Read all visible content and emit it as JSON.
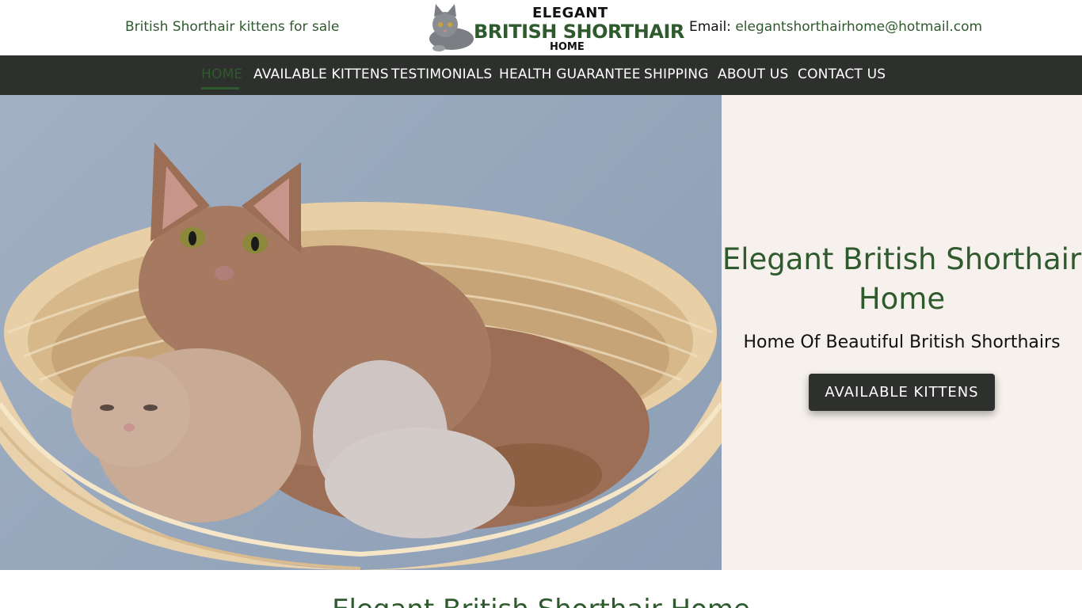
{
  "header": {
    "tagline": "British Shorthair kittens for sale",
    "logo": {
      "line1": "ELEGANT",
      "line2": "BRITISH SHORTHAIR",
      "line3": "HOME"
    },
    "email_label": "Email:",
    "email_address": "elegantshorthairhome@hotmail.com"
  },
  "nav": {
    "items": [
      {
        "label": "HOME",
        "active": true
      },
      {
        "label": "AVAILABLE KITTENS"
      },
      {
        "label": "TESTIMONIALS"
      },
      {
        "label": "HEALTH GUARANTEE"
      },
      {
        "label": "SHIPPING"
      },
      {
        "label": "ABOUT US"
      },
      {
        "label": "CONTACT US"
      }
    ]
  },
  "hero": {
    "image_icon": "cats-in-basket-photo",
    "title": "Elegant British Shorthair Home",
    "subtitle": "Home Of Beautiful British Shorthairs",
    "button": "AVAILABLE KITTENS"
  },
  "section": {
    "title": "Elegant British Shorthair Home"
  },
  "colors": {
    "brand_green": "#2f5a2d",
    "nav_bg": "#2e302e",
    "hero_panel_bg": "#f6f1ec"
  }
}
